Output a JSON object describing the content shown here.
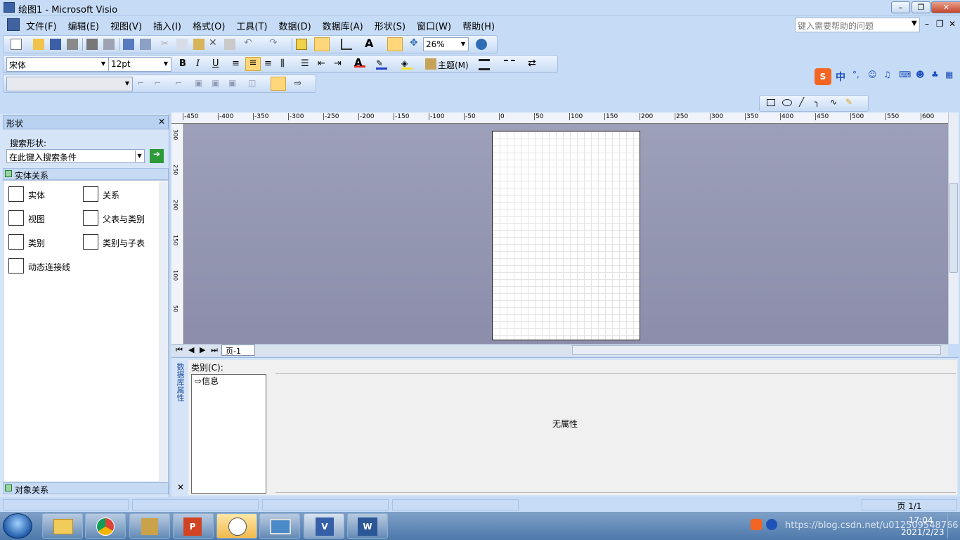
{
  "window": {
    "title": "绘图1 - Microsoft Visio"
  },
  "menus": [
    "文件(F)",
    "编辑(E)",
    "视图(V)",
    "插入(I)",
    "格式(O)",
    "工具(T)",
    "数据(D)",
    "数据库(A)",
    "形状(S)",
    "窗口(W)",
    "帮助(H)"
  ],
  "help_search": {
    "placeholder": "键入需要帮助的问题"
  },
  "toolbar": {
    "zoom": "26%",
    "font": "宋体",
    "font_size": "12pt",
    "theme_label": "主题(M)"
  },
  "shapes": {
    "header": "形状",
    "search_label": "搜索形状:",
    "search_placeholder": "在此键入搜索条件",
    "stencil_title": "实体关系",
    "bottom_stencil": "对象关系",
    "items": [
      {
        "label": "实体",
        "icon": "entity-icon"
      },
      {
        "label": "关系",
        "icon": "relationship-icon"
      },
      {
        "label": "视图",
        "icon": "view-icon"
      },
      {
        "label": "父表与类别",
        "icon": "parent-to-category-icon"
      },
      {
        "label": "类别",
        "icon": "category-icon"
      },
      {
        "label": "类别与子表",
        "icon": "category-to-child-icon"
      },
      {
        "label": "动态连接线",
        "icon": "dynamic-connector-icon"
      }
    ]
  },
  "ruler_top": [
    "-450",
    "-400",
    "-350",
    "-300",
    "-250",
    "-200",
    "-150",
    "-100",
    "-50",
    "0",
    "50",
    "100",
    "150",
    "200",
    "250",
    "300",
    "350",
    "400",
    "450",
    "500",
    "550",
    "600"
  ],
  "ruler_left": [
    "300",
    "250",
    "200",
    "150",
    "100",
    "50"
  ],
  "tabs": {
    "page": "页-1"
  },
  "properties": {
    "side_title": "数据库属性",
    "category_label": "类别(C):",
    "list_item": "信息",
    "empty_message": "无属性"
  },
  "status": {
    "page": "页 1/1"
  },
  "clock": {
    "time": "17:04",
    "date": "2021/2/23"
  },
  "watermark": "https://blog.csdn.net/u012509548766"
}
